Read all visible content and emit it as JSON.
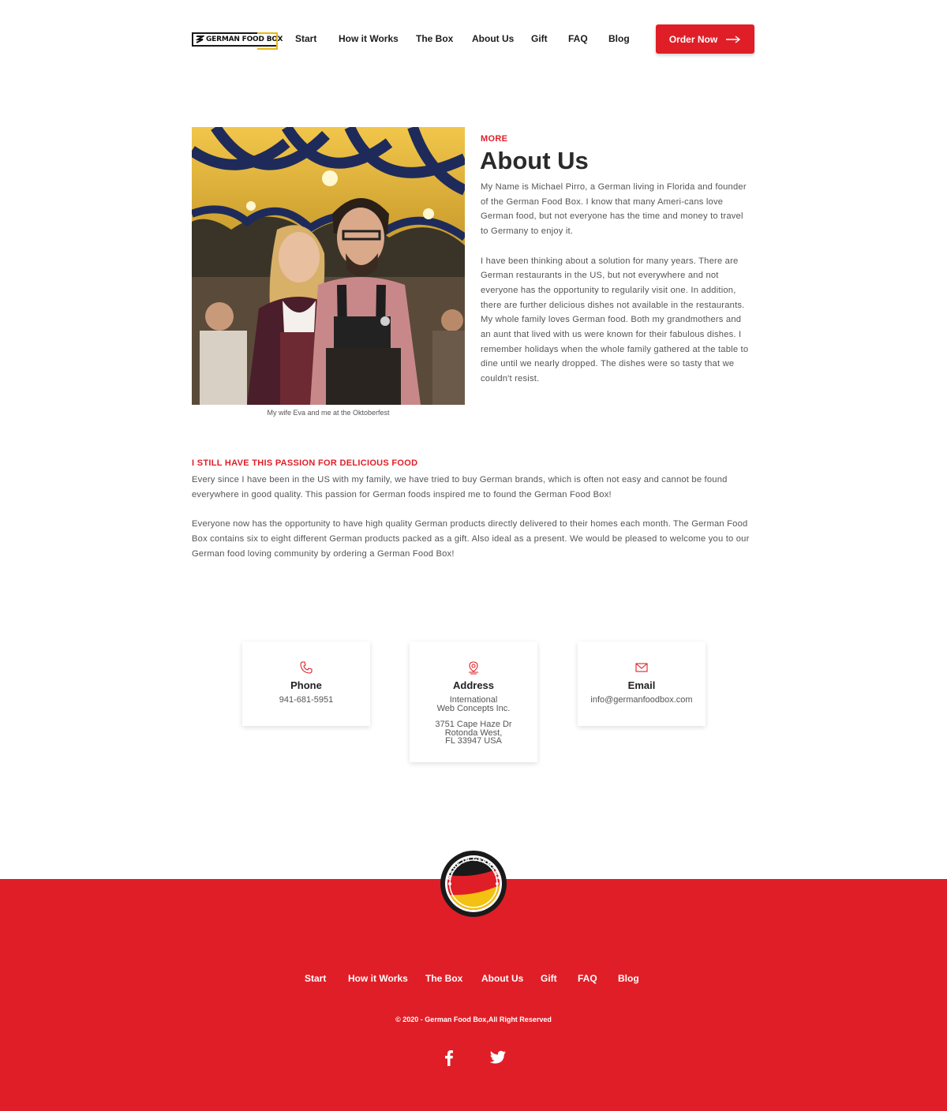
{
  "brand": {
    "logo_text": "GERMAN FOOD BOX",
    "accent": "#e01e27",
    "gold": "#e8b716"
  },
  "nav": {
    "items": [
      "Start",
      "How it Works",
      "The Box",
      "About Us",
      "Gift",
      "FAQ",
      "Blog"
    ],
    "order_button": "Order Now"
  },
  "about": {
    "photo_caption": "My wife Eva and me at the Oktoberfest",
    "eyebrow": "MORE",
    "title": "About Us",
    "paragraphs": [
      "My Name is Michael Pirro, a German living in Florida and founder of the German Food Box. I know that many Ameri-cans love German food, but not everyone has the time and money to travel to Germany to enjoy it.",
      "I have been thinking about a solution for many years. There are German restaurants in the US, but not everywhere and not everyone has the opportunity to regularily visit one. In addition, there are further delicious dishes not available in the restaurants. My whole family loves German food. Both my grandmothers and an aunt that lived with us were known for their fabulous dishes. I remember holidays when the whole family gathered at the table to dine until we nearly dropped. The dishes were so tasty that we couldn't resist."
    ]
  },
  "passion": {
    "title": "I STILL HAVE THIS PASSION FOR DELICIOUS FOOD",
    "paragraphs": [
      "Every since I have been in the US with my family, we have tried to buy German brands, which is often not easy and cannot be found everywhere in good quality. This passion for German foods inspired me to found the German Food Box!",
      "Everyone now has the opportunity to have high quality German products directly delivered to their homes each month. The German Food Box contains six to eight different German products packed as a gift. Also ideal as a present. We would be pleased to welcome you to our German food loving community by ordering a German Food Box!"
    ]
  },
  "contact": {
    "phone": {
      "icon": "phone-icon",
      "title": "Phone",
      "value": "941-681-5951"
    },
    "address": {
      "icon": "location-pin-icon",
      "title": "Address",
      "line1": "International",
      "line2": "Web Concepts Inc.",
      "line3": "3751 Cape Haze Dr",
      "line4": "Rotonda West,",
      "line5": "FL 33947 USA"
    },
    "email": {
      "icon": "envelope-icon",
      "title": "Email",
      "value": "info@germanfoodbox.com"
    }
  },
  "footer": {
    "badge_text": "MADE IN GERMANY",
    "nav": [
      "Start",
      "How it Works",
      "The Box",
      "About Us",
      "Gift",
      "FAQ",
      "Blog"
    ],
    "copyright": "© 2020 - German Food Box,All Right Reserved",
    "social": [
      "facebook-icon",
      "twitter-icon"
    ]
  }
}
